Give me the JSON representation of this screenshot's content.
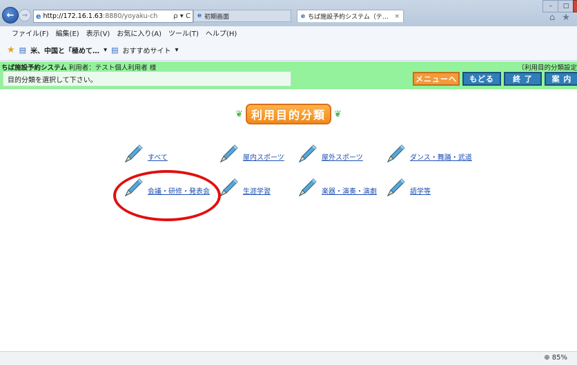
{
  "browser": {
    "address_host": "http://172.16.1.63",
    "address_rest": ":8880/yoyaku-ch",
    "address_controls": "ρ ▾ C",
    "tabs": [
      {
        "label": "初期画面"
      },
      {
        "label": "ちば施設予約システム（テ…",
        "close": "×"
      }
    ],
    "menu": [
      "ファイル(F)",
      "編集(E)",
      "表示(V)",
      "お気に入り(A)",
      "ツール(T)",
      "ヘルプ(H)"
    ],
    "favorites": [
      {
        "label": "米、中国と「極めて…",
        "dropdown": "▾"
      },
      {
        "label": "おすすめサイト",
        "dropdown": "▾"
      }
    ],
    "zoom": "85%"
  },
  "app": {
    "system_name": "ちば施設予約システム",
    "user_info": " 利用者：テスト個人利用者 様",
    "right_info": "〔利用目的分類設定",
    "message": "目的分類を選択して下さい。",
    "buttons": {
      "menu": "メニューへ",
      "back": "もどる",
      "end": "終 了",
      "guide": "案 内"
    },
    "page_title": "利用目的分類",
    "categories": [
      {
        "label": "すべて"
      },
      {
        "label": "屋内スポーツ"
      },
      {
        "label": "屋外スポーツ"
      },
      {
        "label": "ダンス・舞踊・武道"
      },
      {
        "label": "会議・研修・発表会"
      },
      {
        "label": "生涯学習"
      },
      {
        "label": "楽器・演奏・演劇"
      },
      {
        "label": "語学等"
      }
    ]
  },
  "colors": {
    "app_bar": "#93f29b",
    "highlight": "#e00f0f",
    "menu_button": "#f39a3a",
    "nav_button": "#2f7fb8"
  }
}
